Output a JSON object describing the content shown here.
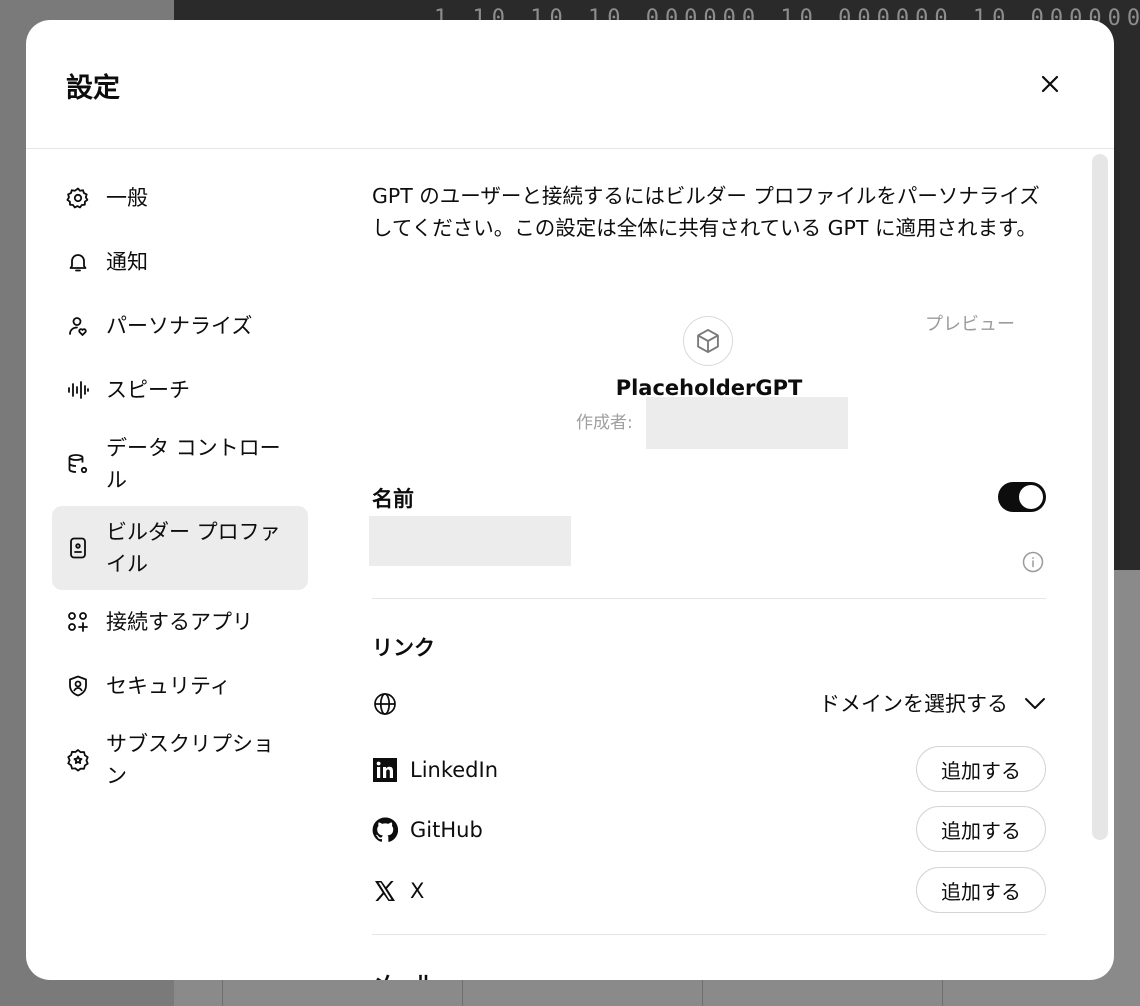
{
  "background": {
    "code_line": "    1    10    10  10.000000   10.000000  10.000000"
  },
  "modal": {
    "title": "設定",
    "close_icon": "close-icon"
  },
  "sidebar": {
    "items": [
      {
        "label": "一般",
        "icon": "gear-icon"
      },
      {
        "label": "通知",
        "icon": "bell-icon"
      },
      {
        "label": "パーソナライズ",
        "icon": "person-heart-icon"
      },
      {
        "label": "スピーチ",
        "icon": "waveform-icon"
      },
      {
        "label": "データ コントロール",
        "icon": "database-gear-icon"
      },
      {
        "label": "ビルダー プロファイル",
        "icon": "id-badge-icon",
        "active": true
      },
      {
        "label": "接続するアプリ",
        "icon": "apps-plus-icon"
      },
      {
        "label": "セキュリティ",
        "icon": "shield-person-icon"
      },
      {
        "label": "サブスクリプション",
        "icon": "star-badge-icon"
      }
    ]
  },
  "content": {
    "description": "GPT のユーザーと接続するにはビルダー プロファイルをパーソナライズしてください。この設定は全体に共有されている GPT に適用されます。",
    "preview_label": "プレビュー",
    "gpt_name": "PlaceholderGPT",
    "creator_label": "作成者: ",
    "name_section": {
      "label": "名前",
      "toggle_on": true
    },
    "links_section": {
      "title": "リンク",
      "domain_select": "ドメインを選択する",
      "accounts": [
        {
          "name": "LinkedIn",
          "icon": "linkedin-icon",
          "button": "追加する"
        },
        {
          "name": "GitHub",
          "icon": "github-icon",
          "button": "追加する"
        },
        {
          "name": "X",
          "icon": "x-logo-icon",
          "button": "追加する"
        }
      ]
    },
    "email_section": {
      "title": "メール"
    }
  }
}
